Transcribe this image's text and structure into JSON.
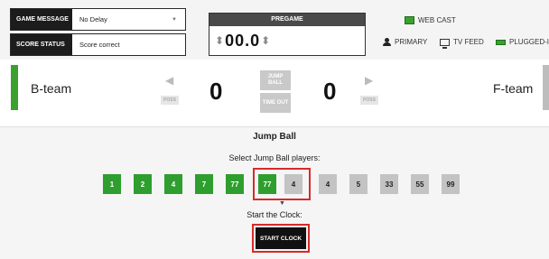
{
  "controls": {
    "game_message": {
      "label": "GAME MESSAGE",
      "value": "No Delay"
    },
    "score_status": {
      "label": "SCORE STATUS",
      "value": "Score correct"
    }
  },
  "clock": {
    "period": "PREGAME",
    "value": "00.0"
  },
  "status": {
    "webcast": "WEB CAST",
    "primary": "PRIMARY",
    "tv_feed": "TV FEED",
    "plugged_in": "PLUGGED-IN"
  },
  "teams": {
    "left": {
      "name": "B-team",
      "score": "0",
      "poss": "POSS"
    },
    "right": {
      "name": "F-team",
      "score": "0",
      "poss": "POSS"
    }
  },
  "center_buttons": {
    "jump_ball": "JUMP BALL",
    "time_out": "TIME OUT"
  },
  "jump_ball": {
    "title": "Jump Ball",
    "select_label": "Select Jump Ball players:",
    "players_left": [
      "1",
      "2",
      "4",
      "7",
      "77"
    ],
    "selected_left": "77",
    "selected_right": "4",
    "players_right": [
      "4",
      "5",
      "33",
      "55",
      "99"
    ],
    "clock_label": "Start the Clock:",
    "start_button": "START CLOCK"
  },
  "colors": {
    "team_green": "#3aa12f",
    "player_grey": "#c3c3c3",
    "highlight_red": "#d62b2b"
  }
}
